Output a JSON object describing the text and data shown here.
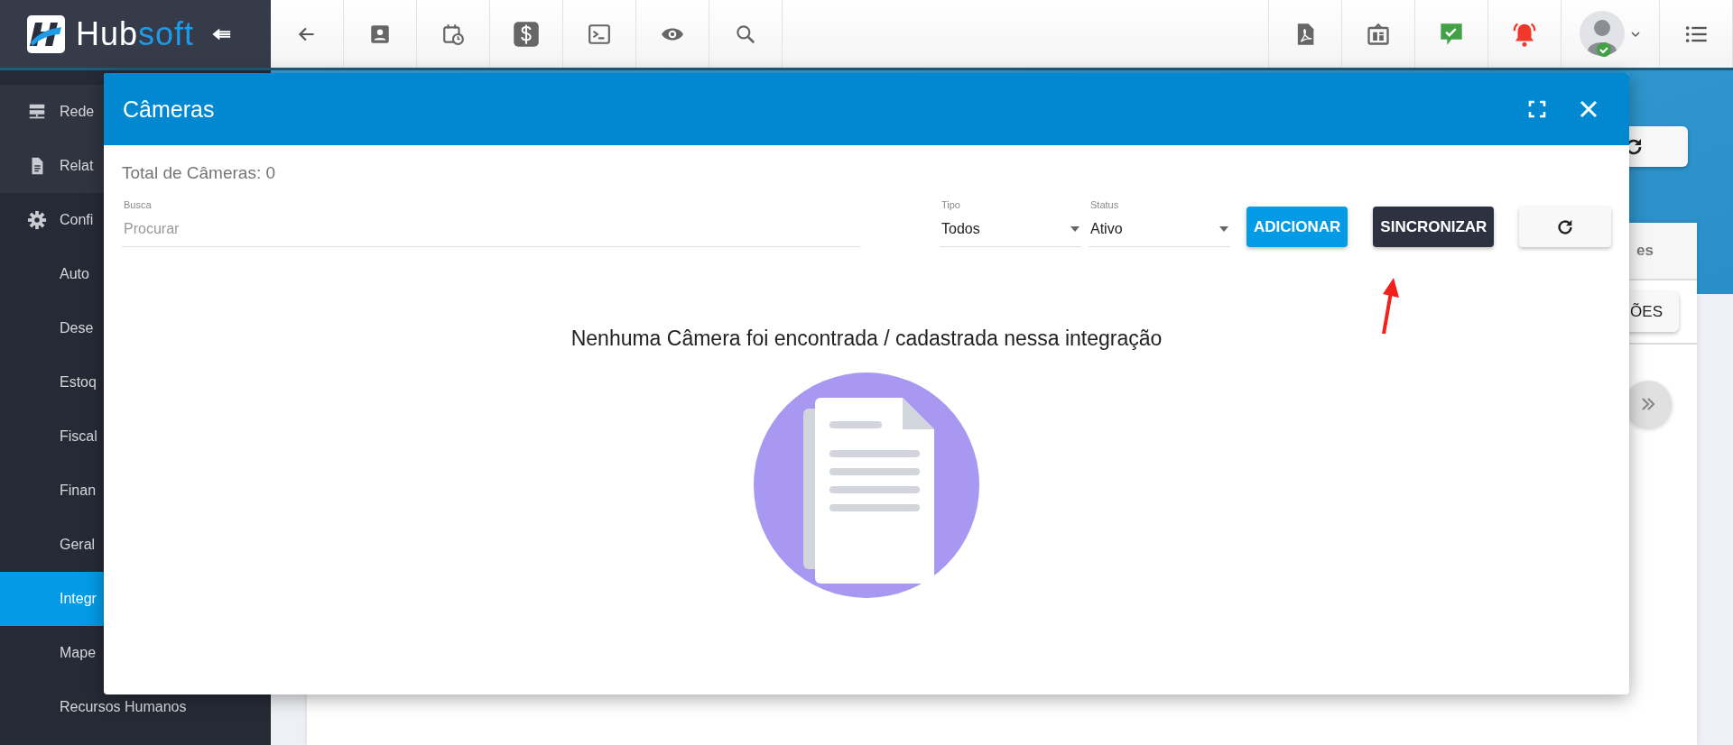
{
  "topbar": {
    "logo": {
      "parts": [
        "Hub",
        "soft"
      ]
    }
  },
  "sidebar": {
    "items": [
      {
        "label": "Rede",
        "selected": false
      },
      {
        "label": "Relat",
        "selected": false
      },
      {
        "label": "Confi",
        "selected": false,
        "children": [
          {
            "label": "Auto",
            "selected": false
          },
          {
            "label": "Dese",
            "selected": false
          },
          {
            "label": "Estoq",
            "selected": false
          },
          {
            "label": "Fiscal",
            "selected": false
          },
          {
            "label": "Finan",
            "selected": false
          },
          {
            "label": "Geral",
            "selected": false
          },
          {
            "label": "Integr",
            "selected": true
          },
          {
            "label": "Mape",
            "selected": false
          },
          {
            "label": "Recursos Humanos",
            "selected": false
          }
        ]
      }
    ]
  },
  "background": {
    "tab_fragment": "es",
    "button_fragment": "ÕES"
  },
  "modal": {
    "title": "Câmeras",
    "total": "Total de Câmeras: 0",
    "search": {
      "label": "Busca",
      "placeholder": "Procurar"
    },
    "selects": [
      {
        "label": "Tipo",
        "value": "Todos"
      },
      {
        "label": "Status",
        "value": "Ativo"
      }
    ],
    "buttons": [
      {
        "kind": "primary",
        "label": "ADICIONAR"
      },
      {
        "kind": "dark",
        "label": "SINCRONIZAR"
      },
      {
        "kind": "refresh"
      }
    ],
    "empty_message": "Nenhuma Câmera foi encontrada / cadastrada nessa integração"
  }
}
